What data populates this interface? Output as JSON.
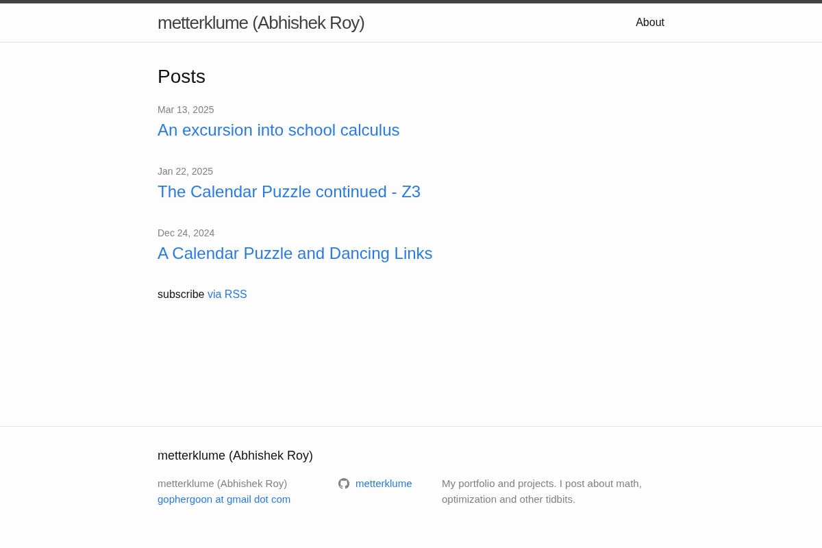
{
  "header": {
    "site_title": "metterklume (Abhishek Roy)",
    "nav": [
      {
        "label": "About"
      }
    ]
  },
  "main": {
    "heading": "Posts",
    "posts": [
      {
        "date": "Mar 13, 2025",
        "title": "An excursion into school calculus"
      },
      {
        "date": "Jan 22, 2025",
        "title": "The Calendar Puzzle continued - Z3"
      },
      {
        "date": "Dec 24, 2024",
        "title": "A Calendar Puzzle and Dancing Links"
      }
    ],
    "subscribe": {
      "text": "subscribe",
      "link": "via RSS"
    }
  },
  "footer": {
    "heading": "metterklume (Abhishek Roy)",
    "name": "metterklume (Abhishek Roy)",
    "email": "gophergoon at gmail dot com",
    "github": "metterklume",
    "description": "My portfolio and projects. I post about math, optimization and other tidbits."
  }
}
